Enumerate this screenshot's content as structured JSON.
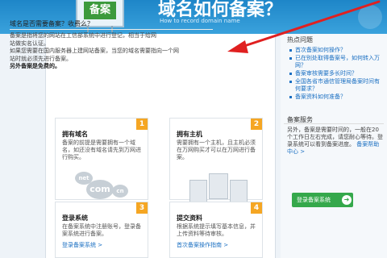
{
  "banner": {
    "board_text": "备案",
    "title": "域名如何备案？",
    "subtitle": "How to record domain name"
  },
  "main": {
    "question": "域名是否需要备案？收费么？",
    "answer_lines": [
      "备案是指将您的网站在工信部系统中进行登记，相当于给网",
      "站做实名认证。",
      "如果您需要在国内服务器上建网站备案，当您的域名需要指向一个网",
      "站时就必须先进行备案。"
    ],
    "answer_strong": "另外备案是免费的。"
  },
  "steps": [
    {
      "badge": "1",
      "title": "拥有域名",
      "desc": "备案的前提是需要拥有一个域名，如还没有域名请先到万网进行购买。",
      "link": ""
    },
    {
      "badge": "2",
      "title": "拥有主机",
      "desc": "需要拥有一个主机，且主机必须在万网购买才可以在万网进行备案。",
      "link": ""
    },
    {
      "badge": "3",
      "title": "登录系统",
      "desc": "在备案系统中注册账号，登录备案系统进行备案。",
      "link": "登录备案系统 >"
    },
    {
      "badge": "4",
      "title": "提交资料",
      "desc": "根据系统提示填写基本信息，并上传资料等待审核。",
      "link": "首次备案操作指南 >"
    }
  ],
  "graphics": {
    "net": "net",
    "com": "com",
    "cn": "cn"
  },
  "sidebar": {
    "hot_title": "热点问题",
    "hot_items": [
      "首次备案如何操作？",
      "已在别处取得备案号，如何转入万网？",
      "备案审核需要多长时间？",
      "全国各省市通信管理局备案时间有何要求？",
      "备案资料如何准备？"
    ],
    "service_title": "备案服务",
    "service_text": "另外，备案是需要时间的，一般在20个工作日左右完成，请您耐心等待。登录系统可以看到备案进度。",
    "service_link": "备案帮助中心 >",
    "button_label": "登录备案系统",
    "button_arrow": "➜"
  },
  "colors": {
    "banner": "#2a94d3",
    "accent_orange": "#f5a623",
    "link_blue": "#1a6fc2",
    "button_green": "#35a84b",
    "annotation_red": "#e02020"
  }
}
